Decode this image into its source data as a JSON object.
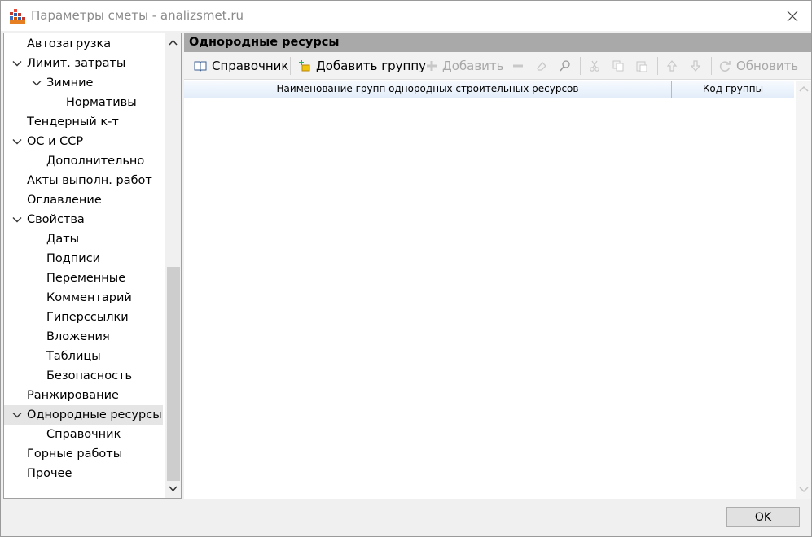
{
  "window": {
    "title": "Параметры сметы - analizsmet.ru"
  },
  "tree": {
    "items": [
      {
        "label": "Автозагрузка",
        "level": 0,
        "expandable": false
      },
      {
        "label": "Лимит. затраты",
        "level": 0,
        "expandable": true
      },
      {
        "label": "Зимние",
        "level": 1,
        "expandable": true
      },
      {
        "label": "Нормативы",
        "level": 2,
        "expandable": false
      },
      {
        "label": "Тендерный к-т",
        "level": 0,
        "expandable": false
      },
      {
        "label": "ОС и ССР",
        "level": 0,
        "expandable": true
      },
      {
        "label": "Дополнительно",
        "level": 1,
        "expandable": false
      },
      {
        "label": "Акты выполн. работ",
        "level": 0,
        "expandable": false
      },
      {
        "label": "Оглавление",
        "level": 0,
        "expandable": false
      },
      {
        "label": "Свойства",
        "level": 0,
        "expandable": true
      },
      {
        "label": "Даты",
        "level": 1,
        "expandable": false
      },
      {
        "label": "Подписи",
        "level": 1,
        "expandable": false
      },
      {
        "label": "Переменные",
        "level": 1,
        "expandable": false
      },
      {
        "label": "Комментарий",
        "level": 1,
        "expandable": false
      },
      {
        "label": "Гиперссылки",
        "level": 1,
        "expandable": false
      },
      {
        "label": "Вложения",
        "level": 1,
        "expandable": false
      },
      {
        "label": "Таблицы",
        "level": 1,
        "expandable": false
      },
      {
        "label": "Безопасность",
        "level": 1,
        "expandable": false
      },
      {
        "label": "Ранжирование",
        "level": 0,
        "expandable": false
      },
      {
        "label": "Однородные ресурсы",
        "level": 0,
        "expandable": true,
        "selected": true
      },
      {
        "label": "Справочник",
        "level": 1,
        "expandable": false
      },
      {
        "label": "Горные работы",
        "level": 0,
        "expandable": false
      },
      {
        "label": "Прочее",
        "level": 0,
        "expandable": false
      }
    ]
  },
  "panel": {
    "header": "Однородные ресурсы",
    "toolbar": {
      "directory_label": "Справочник",
      "add_group_label": "Добавить группу",
      "add_label": "Добавить",
      "refresh_label": "Обновить"
    },
    "grid": {
      "col_name": "Наименование групп однородных строительных ресурсов",
      "col_code": "Код группы"
    }
  },
  "footer": {
    "ok_label": "OK"
  }
}
